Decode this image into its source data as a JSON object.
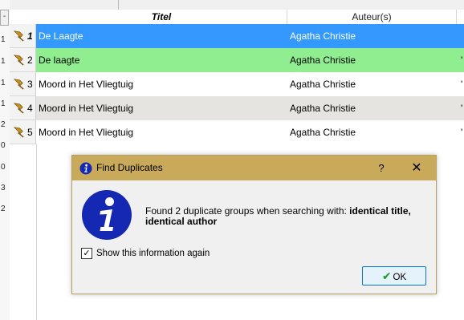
{
  "left_panel": {
    "tab_label": "-",
    "ticks": [
      "1",
      "1",
      "1",
      "1",
      "2",
      "0",
      "0",
      "3",
      "2"
    ]
  },
  "table": {
    "columns": {
      "title": "Titel",
      "author": "Auteur(s)"
    },
    "rows": [
      {
        "num": "1",
        "title": "De Laagte",
        "author": "Agatha Christie",
        "state": "selected"
      },
      {
        "num": "2",
        "title": "De laagte",
        "author": "Agatha Christie",
        "state": "green",
        "edge": "'"
      },
      {
        "num": "3",
        "title": "Moord in Het Vliegtuig",
        "author": "Agatha Christie",
        "state": "white",
        "edge": "'"
      },
      {
        "num": "4",
        "title": "Moord in Het Vliegtuig",
        "author": "Agatha Christie",
        "state": "grey",
        "edge": "'"
      },
      {
        "num": "5",
        "title": "Moord in Het Vliegtuig",
        "author": "Agatha Christie",
        "state": "white",
        "edge": "'"
      }
    ]
  },
  "dialog": {
    "title": "Find Duplicates",
    "help": "?",
    "close": "✕",
    "message_prefix": "Found 2 duplicate groups when searching with: ",
    "message_bold": "identical title, identical author",
    "checkbox_checked": true,
    "checkbox_mark": "✓",
    "checkbox_label": "Show this information again",
    "ok_check": "✔",
    "ok_label": "OK"
  },
  "colors": {
    "selected_row": "#3399ff",
    "green_row": "#90ee90",
    "grey_row": "#e6e4e0",
    "dialog_titlebar": "#c9a95a",
    "info_icon": "#1428b4"
  }
}
